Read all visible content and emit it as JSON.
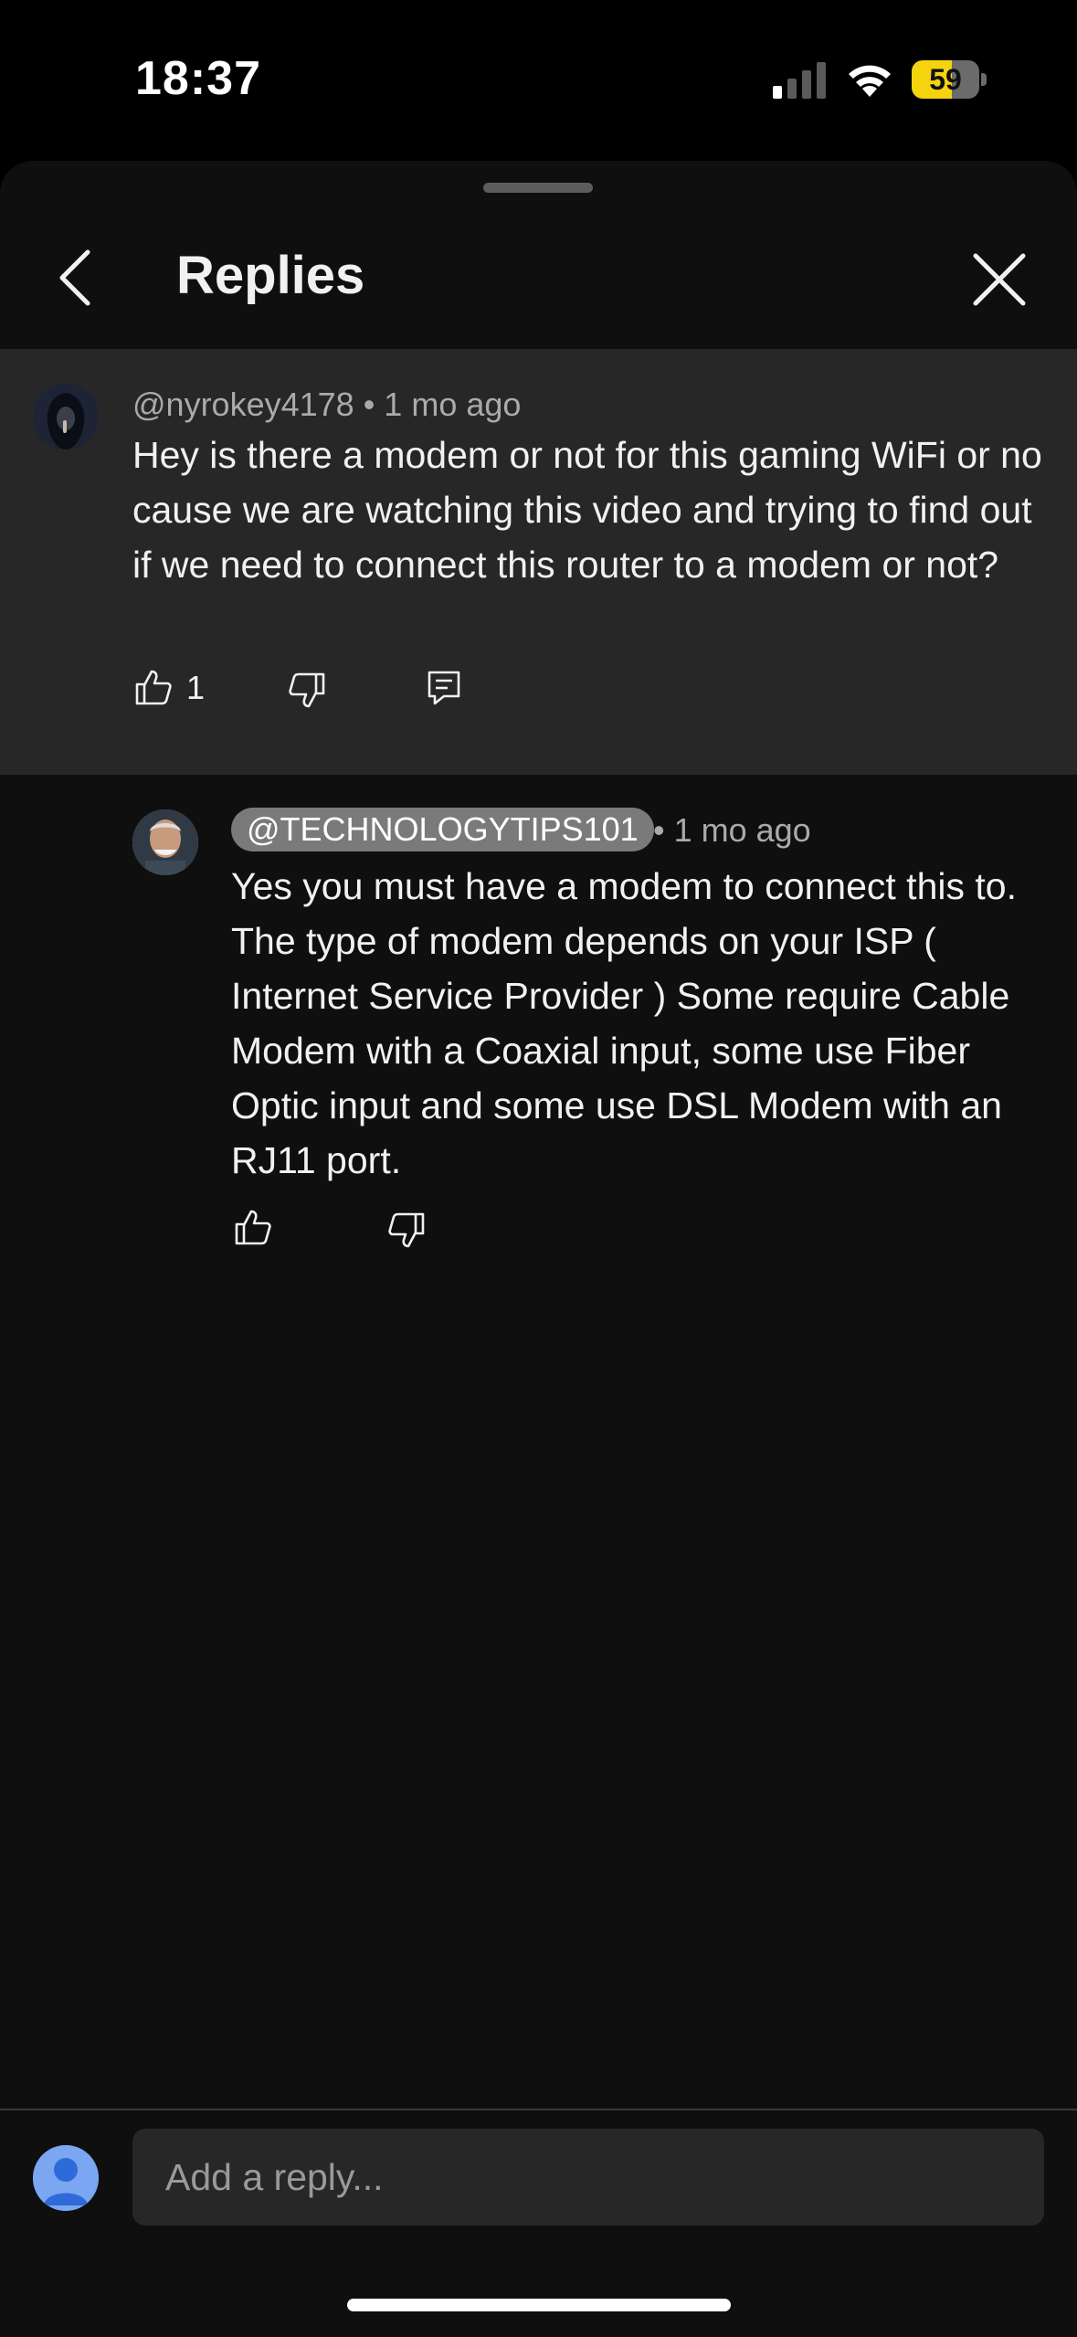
{
  "status_bar": {
    "time": "18:37",
    "battery_percent": "59",
    "battery_level": 0.59,
    "battery_color": "#f5d40d",
    "icons": [
      "signal-icon",
      "wifi-icon",
      "battery-icon"
    ]
  },
  "header": {
    "title": "Replies",
    "back_icon": "chevron-left-icon",
    "close_icon": "close-icon"
  },
  "parent_comment": {
    "author": "@nyrokey4178",
    "time": "• 1 mo ago",
    "text": "Hey is there a modem or not for this gaming WiFi or no cause we are watching this video and trying to find out if we need to connect this router to a modem or not?",
    "like_count": "1",
    "icons": [
      "thumbs-up-icon",
      "thumbs-down-icon",
      "reply-icon"
    ]
  },
  "reply": {
    "author": "@TECHNOLOGYTIPS101",
    "time": "• 1 mo ago",
    "text": "Yes you must have a modem to connect this to. The type of modem depends on your ISP ( Internet Service Provider ) Some require Cable Modem with a Coaxial input, some use Fiber Optic input and some use DSL Modem with an RJ11 port.",
    "icons": [
      "thumbs-up-icon",
      "thumbs-down-icon"
    ]
  },
  "reply_bar": {
    "placeholder": "Add a reply...",
    "value": ""
  },
  "colors": {
    "background": "#0f0f0f",
    "highlight_bg": "#272727",
    "author_pill": "#7a7a7a",
    "muted_text": "#aaaaaa"
  }
}
